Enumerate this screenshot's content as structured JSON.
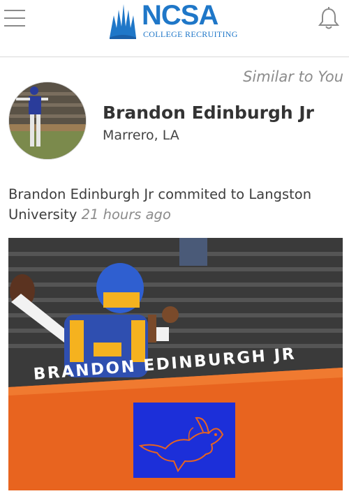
{
  "header": {
    "logo_title": "NCSA",
    "logo_subtitle": "COLLEGE RECRUITING",
    "menu_icon": "hamburger-menu-icon",
    "notification_icon": "bell-icon",
    "brand_color": "#1f77c8"
  },
  "section": {
    "label": "Similar to You"
  },
  "profile": {
    "name": "Brandon Edinburgh Jr",
    "location": "Marrero, LA"
  },
  "post": {
    "text": "Brandon Edinburgh Jr commited to Langston University",
    "time": "21 hours ago",
    "graphic_name": "BRANDON EDINBURGH JR",
    "accent_color": "#e8641f",
    "team_logo_color": "#1c2fd9"
  }
}
